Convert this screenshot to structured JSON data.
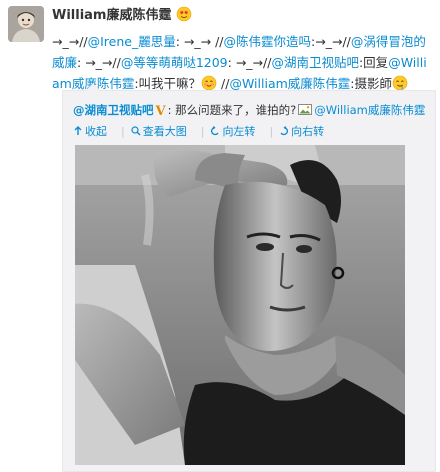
{
  "post": {
    "author": "William廉威陈伟霆",
    "author_emoji": "heart-eyes-emoji-icon",
    "segments": [
      {
        "text": "→_→//",
        "link": false
      },
      {
        "text": "@Irene_麗思量",
        "link": true
      },
      {
        "text": ": →_→ //",
        "link": false
      },
      {
        "text": "@陈伟霆你造吗",
        "link": true
      },
      {
        "text": ":→_→//",
        "link": false
      },
      {
        "text": "@涡得冒泡的威廉",
        "link": true
      },
      {
        "text": ": →_→//",
        "link": false
      },
      {
        "text": "@等等萌萌哒1209",
        "link": true
      },
      {
        "text": ": →_→//",
        "link": false
      },
      {
        "text": "@湖南卫视贴吧",
        "link": true
      },
      {
        "text": ":回复",
        "link": false
      },
      {
        "text": "@William威廉陈伟霆",
        "link": true
      },
      {
        "text": ":叫我干嘛？",
        "link": false
      }
    ],
    "line2": {
      "sep": " //",
      "mention": "@William威廉陈伟霆",
      "tail": ":摄影師"
    }
  },
  "repost": {
    "author": "@湖南卫视贴吧",
    "verified_badge": "V",
    "text": ": 那么问题来了，谁拍的?",
    "mention": "@William威廉陈伟霆",
    "toolbar": {
      "collapse": "收起",
      "view_large": "查看大图",
      "rotate_left": "向左转",
      "rotate_right": "向右转"
    }
  },
  "colors": {
    "link": "#0a8cd2",
    "verified": "#e08a00",
    "repost_bg": "#f2f2f5"
  }
}
